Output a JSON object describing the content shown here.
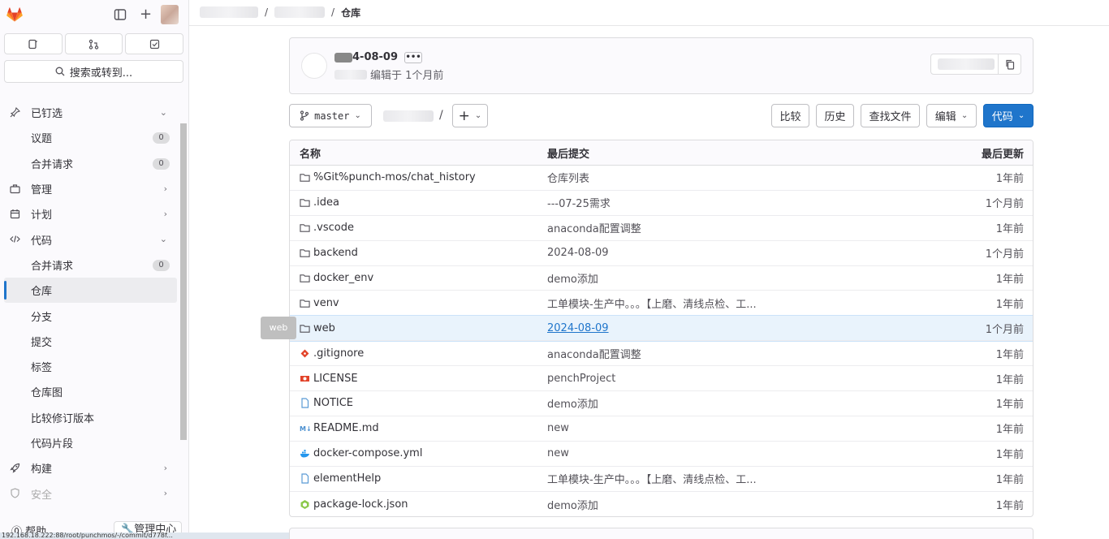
{
  "sidebar": {
    "search_label": "搜索或转到...",
    "nav": [
      {
        "label": "已钉选",
        "icon": "pin-icon",
        "chevron": "⌄"
      },
      {
        "label": "议题",
        "badge": "0"
      },
      {
        "label": "合并请求",
        "badge": "0"
      },
      {
        "label": "管理",
        "icon": "briefcase-icon",
        "chevron": "›"
      },
      {
        "label": "计划",
        "icon": "calendar-icon",
        "chevron": "›"
      },
      {
        "label": "代码",
        "icon": "code-icon",
        "chevron": "⌄"
      },
      {
        "label": "合并请求",
        "badge": "0"
      },
      {
        "label": "仓库",
        "active": true
      },
      {
        "label": "分支"
      },
      {
        "label": "提交"
      },
      {
        "label": "标签"
      },
      {
        "label": "仓库图"
      },
      {
        "label": "比较修订版本"
      },
      {
        "label": "代码片段"
      },
      {
        "label": "构建",
        "icon": "rocket-icon",
        "chevron": "›"
      },
      {
        "label": "安全",
        "icon": "shield-icon",
        "chevron": "›"
      }
    ],
    "help_label": "帮助",
    "admin_label": "管理中心"
  },
  "statusbar": {
    "url": "192.168.18.222:88/root/punchmos/-/commit/d778f..."
  },
  "breadcrumb": {
    "current": "仓库",
    "separator": "/"
  },
  "commit": {
    "title_suffix": "4-08-09",
    "more": "•••",
    "sub_suffix": "编辑于 1个月前"
  },
  "toolbar": {
    "branch": "master",
    "path_sep": "/",
    "add": "+",
    "compare": "比较",
    "history": "历史",
    "find_file": "查找文件",
    "edit": "编辑",
    "code": "代码"
  },
  "table": {
    "headers": {
      "name": "名称",
      "commit": "最后提交",
      "date": "最后更新"
    },
    "rows": [
      {
        "name": "%Git%punch-mos/chat_history",
        "icon": "folder-icon",
        "commit": "仓库列表",
        "date": "1年前"
      },
      {
        "name": ".idea",
        "icon": "folder-icon",
        "commit": "---07-25需求",
        "date": "1个月前"
      },
      {
        "name": ".vscode",
        "icon": "folder-icon",
        "commit": "anaconda配置调整",
        "date": "1年前"
      },
      {
        "name": "backend",
        "icon": "folder-icon",
        "commit": "2024-08-09",
        "date": "1个月前"
      },
      {
        "name": "docker_env",
        "icon": "folder-icon",
        "commit": "demo添加",
        "date": "1年前"
      },
      {
        "name": "venv",
        "icon": "folder-icon",
        "commit": "工单模块-生产中。。。【上磨、清线点检、工...",
        "date": "1年前"
      },
      {
        "name": "web",
        "icon": "folder-icon",
        "commit": "2024-08-09",
        "date": "1个月前",
        "hover": true
      },
      {
        "name": ".gitignore",
        "icon": "git-icon",
        "commit": "anaconda配置调整",
        "date": "1年前"
      },
      {
        "name": "LICENSE",
        "icon": "license-icon",
        "commit": "penchProject",
        "date": "1年前"
      },
      {
        "name": "NOTICE",
        "icon": "file-icon",
        "commit": "demo添加",
        "date": "1年前"
      },
      {
        "name": "README.md",
        "icon": "markdown-icon",
        "commit": "new",
        "date": "1年前"
      },
      {
        "name": "docker-compose.yml",
        "icon": "docker-icon",
        "commit": "new",
        "date": "1年前"
      },
      {
        "name": "elementHelp",
        "icon": "file-icon",
        "commit": "工单模块-生产中。。。【上磨、清线点检、工...",
        "date": "1年前"
      },
      {
        "name": "package-lock.json",
        "icon": "npm-icon",
        "commit": "demo添加",
        "date": "1年前"
      }
    ]
  },
  "tooltip": "web",
  "colors": {
    "primary": "#1f75cb",
    "logo": "#e24329"
  }
}
